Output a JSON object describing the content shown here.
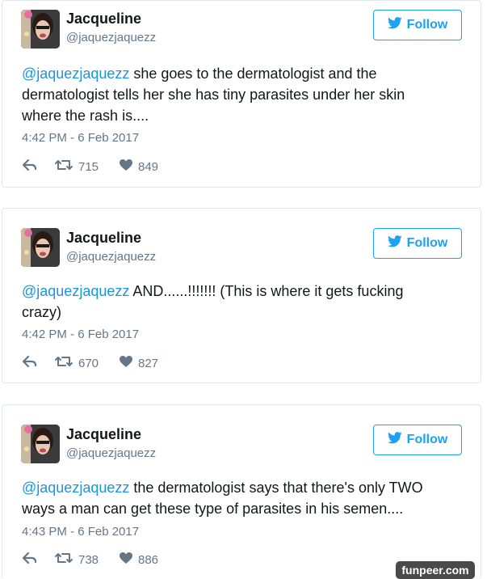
{
  "tweets": [
    {
      "name": "Jacqueline",
      "handle": "@jaquezjaquezz",
      "follow_label": "Follow",
      "mention": "@jaquezjaquezz",
      "text_line1": " she goes to the dermatologist and the",
      "text_line2": "dermatologist tells her she has tiny parasites under her skin",
      "text_line3": "where the rash is....",
      "timestamp": "4:42 PM - 6 Feb 2017",
      "retweets": "715",
      "likes": "849"
    },
    {
      "name": "Jacqueline",
      "handle": "@jaquezjaquezz",
      "follow_label": "Follow",
      "mention": "@jaquezjaquezz",
      "text_line1": " AND......!!!!!!! (This is where it gets fucking",
      "text_line2": "crazy)",
      "timestamp": "4:42 PM - 6 Feb 2017",
      "retweets": "670",
      "likes": "827"
    },
    {
      "name": "Jacqueline",
      "handle": "@jaquezjaquezz",
      "follow_label": "Follow",
      "mention": "@jaquezjaquezz",
      "text_line1": " the dermatologist says that there's only TWO",
      "text_line2": "ways a man can get these type of parasites in his semen....",
      "timestamp": "4:43 PM - 6 Feb 2017",
      "retweets": "738",
      "likes": "886"
    }
  ],
  "watermark": "funpeer.com",
  "colors": {
    "accent": "#1da1f2",
    "mention": "#1b95e0",
    "meta": "#657786",
    "border": "#e1e8ed"
  },
  "icons": [
    "bird-icon",
    "reply-icon",
    "retweet-icon",
    "heart-icon"
  ]
}
